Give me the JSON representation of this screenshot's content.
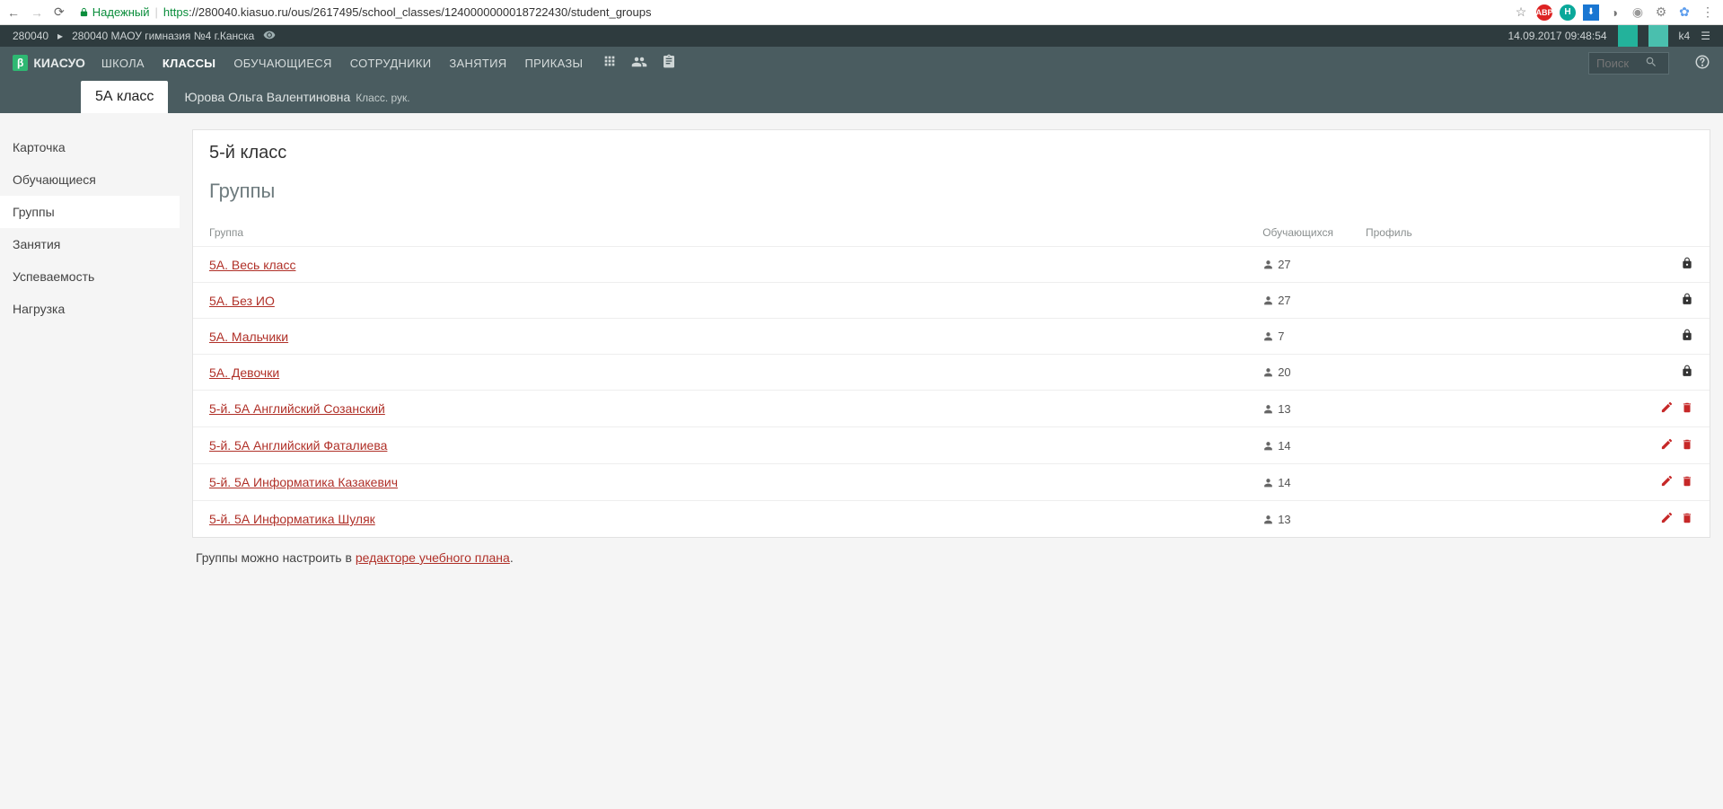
{
  "browser": {
    "secure_label": "Надежный",
    "url_https": "https",
    "url_rest": "://280040.kiasuo.ru/ous/2617495/school_classes/1240000000018722430/student_groups"
  },
  "topbar1": {
    "code": "280040",
    "path": "280040 МАОУ гимназия №4 г.Канска",
    "datetime": "14.09.2017 09:48:54",
    "user": "k4"
  },
  "logo": {
    "badge": "β",
    "text": "КИАСУО"
  },
  "nav": {
    "items": [
      {
        "label": "ШКОЛА",
        "active": false
      },
      {
        "label": "КЛАССЫ",
        "active": true
      },
      {
        "label": "ОБУЧАЮЩИЕСЯ",
        "active": false
      },
      {
        "label": "СОТРУДНИКИ",
        "active": false
      },
      {
        "label": "ЗАНЯТИЯ",
        "active": false
      },
      {
        "label": "ПРИКАЗЫ",
        "active": false
      }
    ],
    "search_placeholder": "Поиск"
  },
  "subbar": {
    "class_tab": "5А класс",
    "teacher_name": "Юрова Ольга Валентиновна",
    "teacher_role": "Класс. рук."
  },
  "sidebar": {
    "items": [
      {
        "label": "Карточка",
        "active": false
      },
      {
        "label": "Обучающиеся",
        "active": false
      },
      {
        "label": "Группы",
        "active": true
      },
      {
        "label": "Занятия",
        "active": false
      },
      {
        "label": "Успеваемость",
        "active": false
      },
      {
        "label": "Нагрузка",
        "active": false
      }
    ]
  },
  "main": {
    "title": "5-й класс",
    "subtitle": "Группы",
    "columns": {
      "group": "Группа",
      "count": "Обучающихся",
      "profile": "Профиль"
    },
    "rows": [
      {
        "name": "5А. Весь класс",
        "count": "27",
        "locked": true
      },
      {
        "name": "5А. Без ИО",
        "count": "27",
        "locked": true
      },
      {
        "name": "5А. Мальчики",
        "count": "7",
        "locked": true
      },
      {
        "name": "5А. Девочки",
        "count": "20",
        "locked": true
      },
      {
        "name": "5-й. 5А Английский Созанский",
        "count": "13",
        "locked": false
      },
      {
        "name": "5-й. 5А Английский Фаталиева",
        "count": "14",
        "locked": false
      },
      {
        "name": "5-й. 5А Информатика Казакевич",
        "count": "14",
        "locked": false
      },
      {
        "name": "5-й. 5А Информатика Шуляк",
        "count": "13",
        "locked": false
      }
    ],
    "footnote_text": "Группы можно настроить в ",
    "footnote_link": "редакторе учебного плана",
    "footnote_period": "."
  }
}
